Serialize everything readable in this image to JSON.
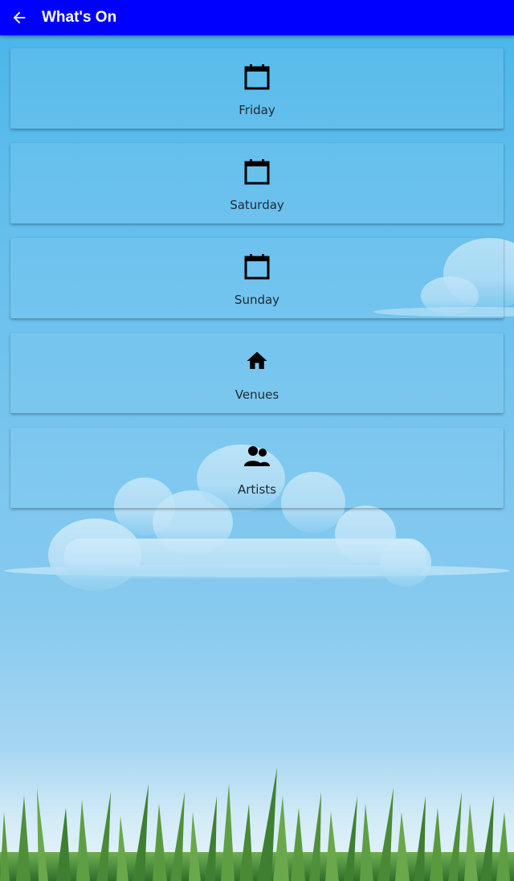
{
  "appbar": {
    "title": "What's On",
    "back_icon": "arrow-left-icon",
    "color": "#0000ff"
  },
  "menu": {
    "items": [
      {
        "label": "Friday",
        "icon": "calendar-icon"
      },
      {
        "label": "Saturday",
        "icon": "calendar-icon"
      },
      {
        "label": "Sunday",
        "icon": "calendar-icon"
      },
      {
        "label": "Venues",
        "icon": "home-icon"
      },
      {
        "label": "Artists",
        "icon": "people-icon"
      }
    ]
  },
  "background": {
    "sky_color": "#47b4e9",
    "grass_color": "#4f8f3a"
  }
}
